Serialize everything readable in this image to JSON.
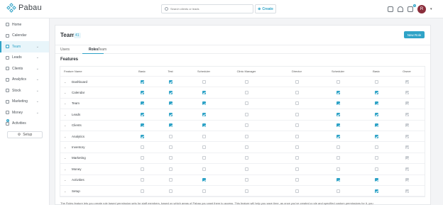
{
  "app": {
    "name": "Pabau"
  },
  "search": {
    "placeholder": "Search clients or leads"
  },
  "create": {
    "label": "Create"
  },
  "topbar": {
    "notification_count": "0",
    "avatar_initial": "R"
  },
  "sidebar": {
    "items": [
      {
        "label": "Home",
        "chevron": false,
        "active": false
      },
      {
        "label": "Calendar",
        "chevron": false,
        "active": false
      },
      {
        "label": "Team",
        "chevron": true,
        "active": true
      },
      {
        "label": "Leads",
        "chevron": true,
        "active": false
      },
      {
        "label": "Clients",
        "chevron": true,
        "active": false
      },
      {
        "label": "Analytics",
        "chevron": true,
        "active": false
      },
      {
        "label": "Stock",
        "chevron": true,
        "active": false
      },
      {
        "label": "Marketing",
        "chevron": true,
        "active": false
      },
      {
        "label": "Money",
        "chevron": true,
        "active": false
      },
      {
        "label": "Activities",
        "chevron": false,
        "active": false,
        "badge": "0"
      }
    ],
    "setup_label": "Setup"
  },
  "page": {
    "title": "Team",
    "count": "41",
    "new_role_label": "New Role",
    "tabs": [
      "Users",
      "Roles",
      "Team"
    ],
    "active_tab": 1,
    "section_title": "Features"
  },
  "table": {
    "feature_header": "Feature Name",
    "columns": [
      "Basic",
      "Test",
      "Scheduler",
      "Clinic Manager",
      "Director",
      "Scheduler",
      "Basic",
      "Owner"
    ],
    "rows": [
      {
        "name": "Dashboard",
        "values": [
          1,
          1,
          0,
          0,
          0,
          0,
          0,
          2
        ]
      },
      {
        "name": "Calendar",
        "values": [
          1,
          1,
          1,
          0,
          0,
          1,
          1,
          2
        ]
      },
      {
        "name": "Team",
        "values": [
          1,
          1,
          1,
          0,
          0,
          1,
          1,
          2
        ]
      },
      {
        "name": "Leads",
        "values": [
          1,
          1,
          1,
          0,
          0,
          1,
          1,
          2
        ]
      },
      {
        "name": "Clients",
        "values": [
          1,
          1,
          1,
          0,
          0,
          1,
          1,
          2
        ]
      },
      {
        "name": "Analytics",
        "values": [
          1,
          0,
          0,
          0,
          0,
          1,
          1,
          2
        ]
      },
      {
        "name": "Inventory",
        "values": [
          0,
          0,
          0,
          0,
          0,
          0,
          0,
          2
        ]
      },
      {
        "name": "Marketing",
        "values": [
          0,
          0,
          0,
          0,
          0,
          0,
          0,
          2
        ]
      },
      {
        "name": "Money",
        "values": [
          0,
          0,
          0,
          0,
          0,
          0,
          0,
          2
        ]
      },
      {
        "name": "Activities",
        "values": [
          0,
          0,
          1,
          0,
          0,
          1,
          1,
          2
        ]
      },
      {
        "name": "Setup",
        "values": [
          0,
          0,
          0,
          0,
          0,
          0,
          1,
          2
        ]
      }
    ]
  },
  "footnote": "The Roles feature lets you create role based permission sets for staff members, based on which areas of Pabau you want them to access. This feature will help you save time, as once you've created a role and specified custom permissions for it, you"
}
